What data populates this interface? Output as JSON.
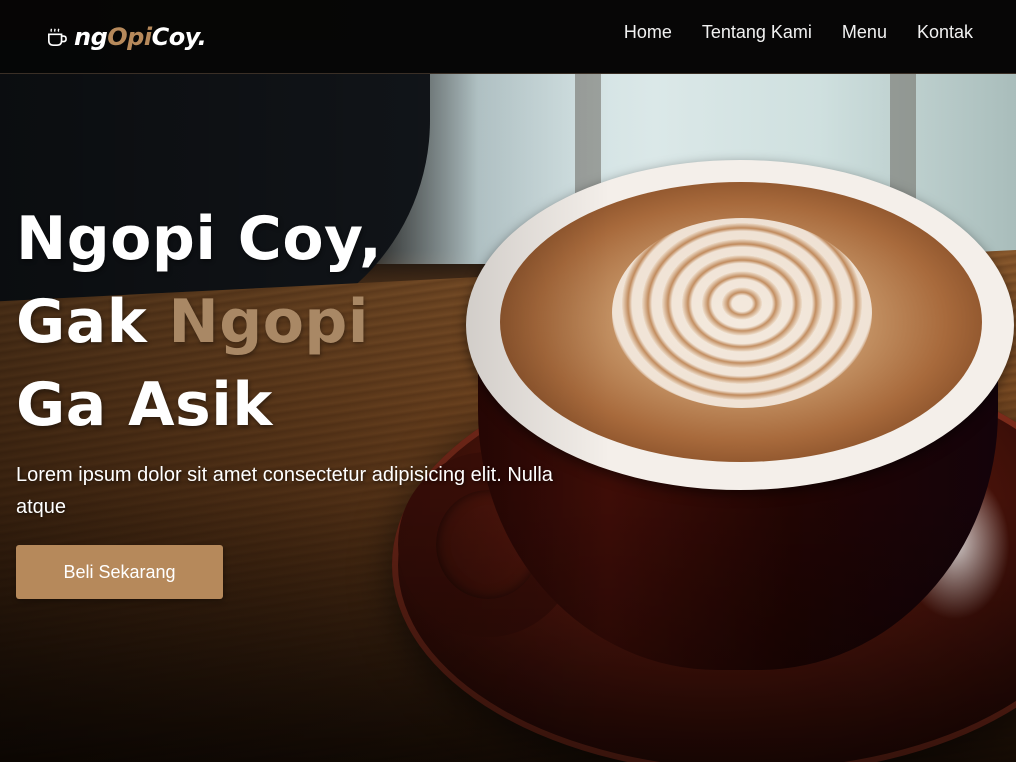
{
  "brand": {
    "prefix": "ng",
    "accent": "Opi",
    "suffix": "Coy.",
    "icon": "coffee-cup-icon"
  },
  "nav": {
    "items": [
      {
        "label": "Home"
      },
      {
        "label": "Tentang Kami"
      },
      {
        "label": "Menu"
      },
      {
        "label": "Kontak"
      }
    ]
  },
  "hero": {
    "line1": "Ngopi Coy,",
    "line2_prefix": "Gak ",
    "line2_accent": "Ngopi",
    "line3": "Ga Asik",
    "description": "Lorem ipsum dolor sit amet consectetur adipisicing elit. Nulla atque",
    "cta_label": "Beli Sekarang"
  },
  "colors": {
    "primary": "#b6895b",
    "navbar_bg": "#050505",
    "text": "#ffffff"
  }
}
